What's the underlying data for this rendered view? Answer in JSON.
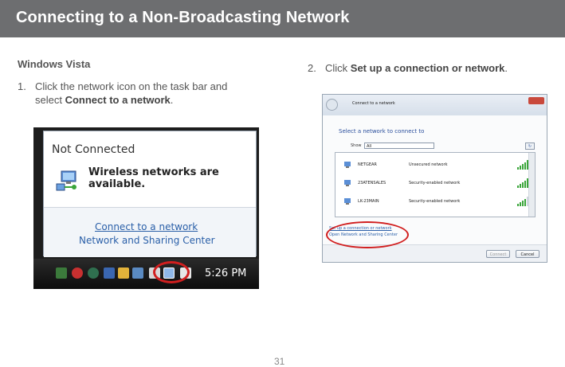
{
  "header": {
    "title": "Connecting to a Non-Broadcasting Network"
  },
  "section_title": "Windows Vista",
  "step1": {
    "number": "1.",
    "text_a": "Click the network icon on the task bar and",
    "text_b": "select ",
    "bold": "Connect to a network",
    "end": "."
  },
  "step2": {
    "number": "2.",
    "text": "Click ",
    "bold": "Set up a connection or network",
    "end": "."
  },
  "shot1": {
    "status": "Not Connected",
    "message": "Wireless networks are available.",
    "link1": "Connect to a network",
    "link2": "Network and Sharing Center",
    "clock": "5:26 PM"
  },
  "shot2": {
    "title": "Connect to a network",
    "heading": "Select a network to connect to",
    "show_label": "Show",
    "show_value": "All",
    "networks": [
      {
        "name": "NETGEAR",
        "status": "Unsecured network"
      },
      {
        "name": "23ATENSALES",
        "status": "Security-enabled network"
      },
      {
        "name": "LK-23MAIN",
        "status": "Security-enabled network"
      }
    ],
    "link_setup": "Set up a connection or network",
    "link_center": "Open Network and Sharing Center",
    "connect_label": "Connect",
    "cancel_label": "Cancel"
  },
  "page_number": "31",
  "colors": {
    "header_bg": "#6d6e70",
    "highlight": "#d11f1f",
    "link": "#2a5fa8"
  }
}
